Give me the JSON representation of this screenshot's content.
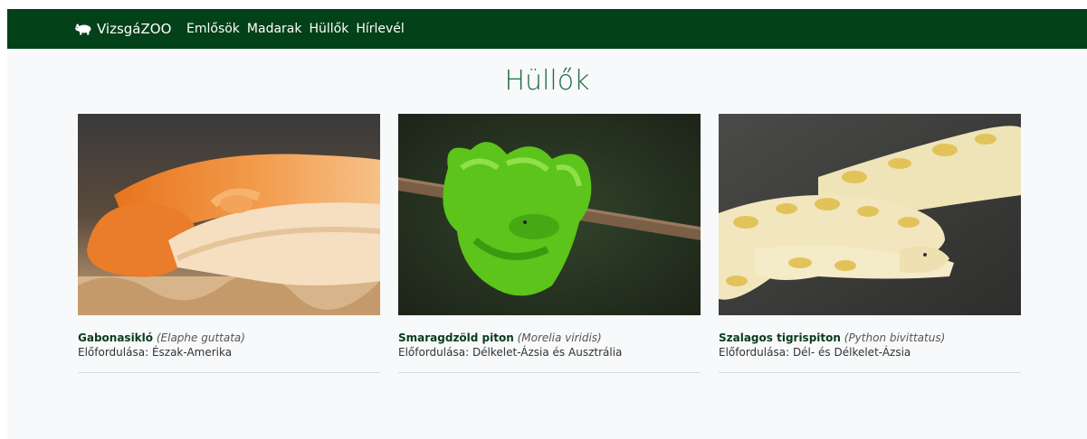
{
  "navbar": {
    "brand": "VizsgáZOO",
    "links": [
      "Emlősök",
      "Madarak",
      "Hüllők",
      "Hírlevél"
    ]
  },
  "page_title": "Hüllők",
  "colors": {
    "navbar_bg": "#034118",
    "title": "#1e6b3f",
    "page_bg": "#f8f9fa"
  },
  "cards": [
    {
      "name": "Gabonasikló",
      "latin": "(Elaphe guttata)",
      "region_label": "Előfordulása:",
      "region": "Észak-Amerika"
    },
    {
      "name": "Smaragdzöld piton",
      "latin": "(Morelia viridis)",
      "region_label": "Előfordulása:",
      "region": "Délkelet-Ázsia és Ausztrália"
    },
    {
      "name": "Szalagos tigrispiton",
      "latin": "(Python bivittatus)",
      "region_label": "Előfordulása:",
      "region": "Dél- és Délkelet-Ázsia"
    }
  ]
}
